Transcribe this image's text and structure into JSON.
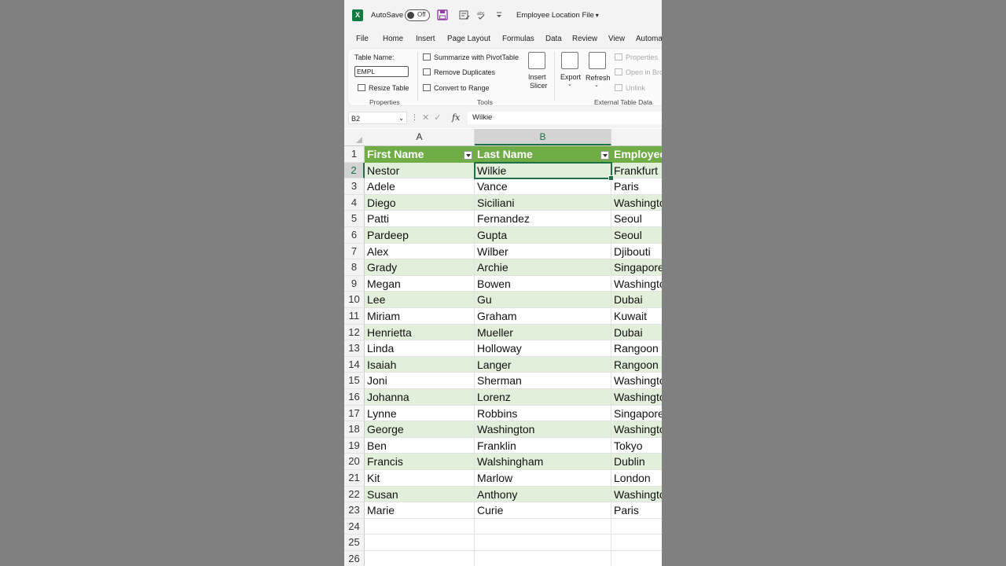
{
  "titlebar": {
    "autosave_label": "AutoSave",
    "autosave_state": "Off",
    "document_title": "Employee Location File",
    "logo_letter": "X"
  },
  "tabs": [
    "File",
    "Home",
    "Insert",
    "Page Layout",
    "Formulas",
    "Data",
    "Review",
    "View",
    "Automate"
  ],
  "ribbon": {
    "properties": {
      "table_name_label": "Table Name:",
      "table_name_value": "EMPL",
      "resize_table": "Resize Table",
      "group_label": "Properties"
    },
    "tools": {
      "summarize": "Summarize with PivotTable",
      "remove_duplicates": "Remove Duplicates",
      "convert_to_range": "Convert to Range",
      "insert_slicer_1": "Insert",
      "insert_slicer_2": "Slicer",
      "group_label": "Tools"
    },
    "external": {
      "export": "Export",
      "refresh": "Refresh",
      "properties": "Properties",
      "open_in_browser": "Open in Bro",
      "unlink": "Unlink",
      "group_label": "External Table Data"
    }
  },
  "formula_bar": {
    "name_box": "B2",
    "fx": "fx",
    "formula": "Wilkie"
  },
  "grid": {
    "columns": [
      "A",
      "B",
      ""
    ],
    "selected_column": "B",
    "header_row": [
      "First Name",
      "Last Name",
      "Employee"
    ],
    "rows": [
      [
        "Nestor",
        "Wilkie",
        "Frankfurt"
      ],
      [
        "Adele",
        "Vance",
        "Paris"
      ],
      [
        "Diego",
        "Siciliani",
        "Washington"
      ],
      [
        "Patti",
        "Fernandez",
        "Seoul"
      ],
      [
        "Pardeep",
        "Gupta",
        "Seoul"
      ],
      [
        "Alex",
        "Wilber",
        "Djibouti"
      ],
      [
        "Grady",
        "Archie",
        "Singapore"
      ],
      [
        "Megan",
        "Bowen",
        "Washington"
      ],
      [
        "Lee",
        "Gu",
        "Dubai"
      ],
      [
        "Miriam",
        "Graham",
        "Kuwait"
      ],
      [
        "Henrietta",
        "Mueller",
        "Dubai"
      ],
      [
        "Linda",
        "Holloway",
        "Rangoon"
      ],
      [
        "Isaiah",
        "Langer",
        "Rangoon"
      ],
      [
        "Joni",
        "Sherman",
        "Washington"
      ],
      [
        "Johanna",
        "Lorenz",
        "Washington"
      ],
      [
        "Lynne",
        "Robbins",
        "Singapore"
      ],
      [
        "George",
        "Washington",
        "Washington"
      ],
      [
        "Ben",
        "Franklin",
        "Tokyo"
      ],
      [
        "Francis",
        "Walshingham",
        "Dublin"
      ],
      [
        "Kit",
        "Marlow",
        "London"
      ],
      [
        "Susan",
        "Anthony",
        "Washington"
      ],
      [
        "Marie",
        "Curie",
        "Paris"
      ]
    ],
    "empty_rows": [
      24,
      25,
      26
    ],
    "active_row": 2
  },
  "colors": {
    "header_green": "#70ad47",
    "band_green": "#e2efda",
    "accent": "#1e7145"
  }
}
